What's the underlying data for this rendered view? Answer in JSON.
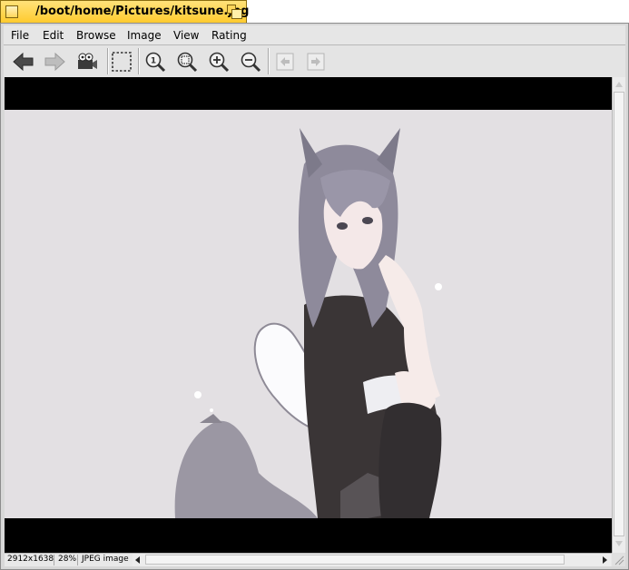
{
  "window": {
    "title": "/boot/home/Pictures/kitsune.jpg"
  },
  "menu": [
    "File",
    "Edit",
    "Browse",
    "Image",
    "View",
    "Rating"
  ],
  "toolbar": {
    "icons": [
      "back-arrow-icon",
      "forward-arrow-icon",
      "slideshow-projector-icon",
      "select-region-icon",
      "original-size-icon",
      "fit-to-window-icon",
      "zoom-in-icon",
      "zoom-out-icon",
      "previous-page-icon",
      "next-page-icon"
    ]
  },
  "status": {
    "dimensions": "2912x1638",
    "zoom": "28%",
    "type": "JPEG image"
  },
  "colors": {
    "tab": "#ffcb2e",
    "image_bg": "#e3e0e3",
    "letterbox": "#000000"
  }
}
